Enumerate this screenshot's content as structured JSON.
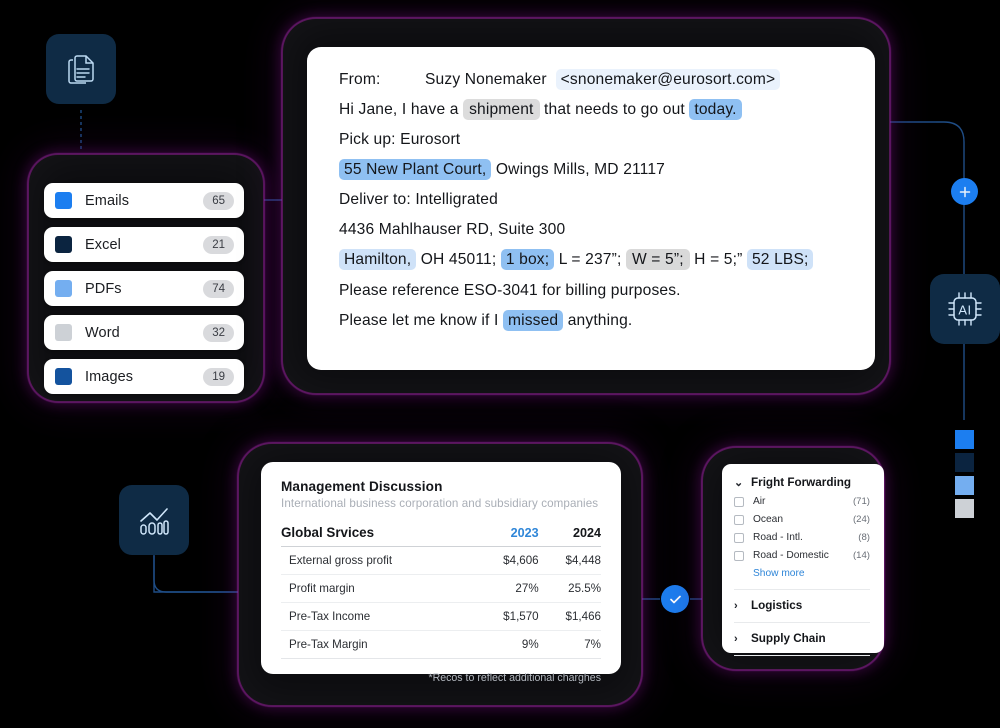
{
  "sidebar": {
    "items": [
      {
        "label": "Emails",
        "count": "65",
        "color": "#1c7ef0"
      },
      {
        "label": "Excel",
        "count": "21",
        "color": "#0b2440"
      },
      {
        "label": "PDFs",
        "count": "74",
        "color": "#74aef0"
      },
      {
        "label": "Word",
        "count": "32",
        "color": "#cdd1d6"
      },
      {
        "label": "Images",
        "count": "19",
        "color": "#14539e"
      }
    ]
  },
  "email": {
    "from_label": "From:",
    "sender_name": "Suzy Nonemaker",
    "sender_address": "<snonemaker@eurosort.com>",
    "line_greeting_a": "Hi Jane, I have a",
    "hl_shipment": "shipment",
    "line_greeting_b": "that needs to go out",
    "hl_today": "today.",
    "pickup_line": "Pick up: Eurosort",
    "hl_street": "55 New Plant Court,",
    "pickup_city": "Owings Mills, MD 21117",
    "deliver_line": "Deliver to: Intelligrated",
    "deliver_street": "4436 Mahlhauser RD, Suite 300",
    "hl_hamilton": "Hamilton,",
    "deliver_state": "OH 45011;",
    "hl_box": "1 box;",
    "dim_l": "L = 237”;",
    "hl_w": "W = 5”;",
    "dim_h": "H = 5;”",
    "hl_weight": "52 LBS;",
    "reference_line": "Please reference ESO-3041 for billing purposes.",
    "closing_a": "Please let me know if I",
    "hl_missed": "missed",
    "closing_b": "anything."
  },
  "financial": {
    "title": "Management Discussion",
    "subtitle": "International business corporation and subsidiary companies",
    "col_label": "Global Srvices",
    "year_1": "2023",
    "year_2": "2024",
    "rows": [
      {
        "label": "External gross profit",
        "v2023": "$4,606",
        "v2024": "$4,448"
      },
      {
        "label": "Profit margin",
        "v2023": "27%",
        "v2024": "25.5%"
      },
      {
        "label": "Pre-Tax Income",
        "v2023": "$1,570",
        "v2024": "$1,466"
      },
      {
        "label": "Pre-Tax Margin",
        "v2023": "9%",
        "v2024": "7%"
      }
    ],
    "footnote": "*Recos to reflect additional charghes",
    "accent": "#2f86d8"
  },
  "filters": {
    "groups": [
      {
        "name": "Fright Forwarding",
        "expanded": true,
        "chevron": "⌄",
        "options": [
          {
            "label": "Air",
            "count": "(71)"
          },
          {
            "label": "Ocean",
            "count": "(24)"
          },
          {
            "label": "Road - Intl.",
            "count": "(8)"
          },
          {
            "label": "Road - Domestic",
            "count": "(14)"
          }
        ],
        "show_more": "Show more"
      },
      {
        "name": "Logistics",
        "expanded": false,
        "chevron": "›"
      },
      {
        "name": "Supply Chain",
        "expanded": false,
        "chevron": "›"
      }
    ]
  },
  "icons": {
    "documents": "documents-icon",
    "chart": "bar-chart-trend-icon",
    "ai": "ai-chip-icon",
    "add_node": "plus-icon",
    "done_node": "check-icon"
  },
  "legend_squares": [
    {
      "name": "emails",
      "color": "#1c7ef0"
    },
    {
      "name": "excel",
      "color": "#0b2440"
    },
    {
      "name": "pdfs",
      "color": "#74aef0"
    },
    {
      "name": "word",
      "color": "#cdd1d6"
    }
  ]
}
